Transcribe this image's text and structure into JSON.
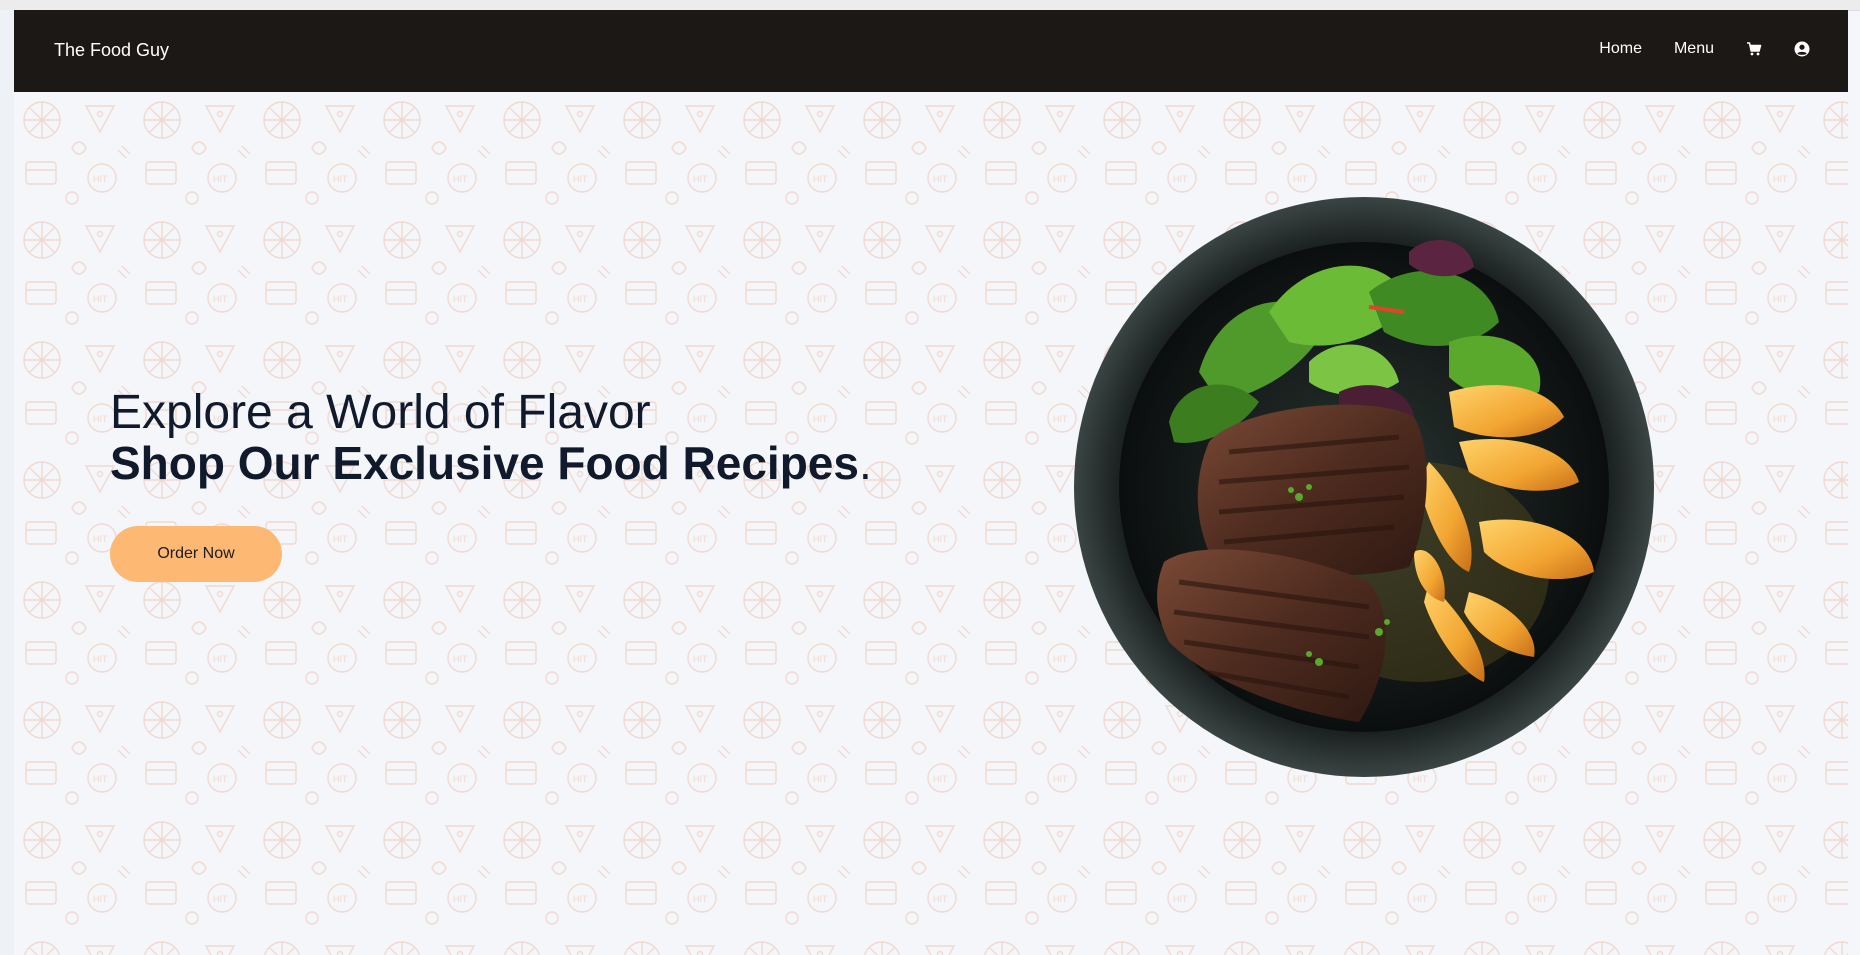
{
  "header": {
    "brand": "The Food Guy",
    "nav": [
      {
        "label": "Home"
      },
      {
        "label": "Menu"
      }
    ],
    "icons": [
      "cart-icon",
      "user-account-icon"
    ]
  },
  "hero": {
    "headline_line1": "Explore a World of Flavor",
    "headline_line2": "Shop Our Exclusive Food Recipes",
    "headline_period": ".",
    "cta_label": "Order Now",
    "image": "steak-salad-potatoes-plate"
  },
  "colors": {
    "navbar_bg": "#1c1816",
    "page_bg": "#f4f6fa",
    "headline": "#101a2c",
    "cta_bg": "#fdb874",
    "pattern": "#f0d9d0"
  }
}
